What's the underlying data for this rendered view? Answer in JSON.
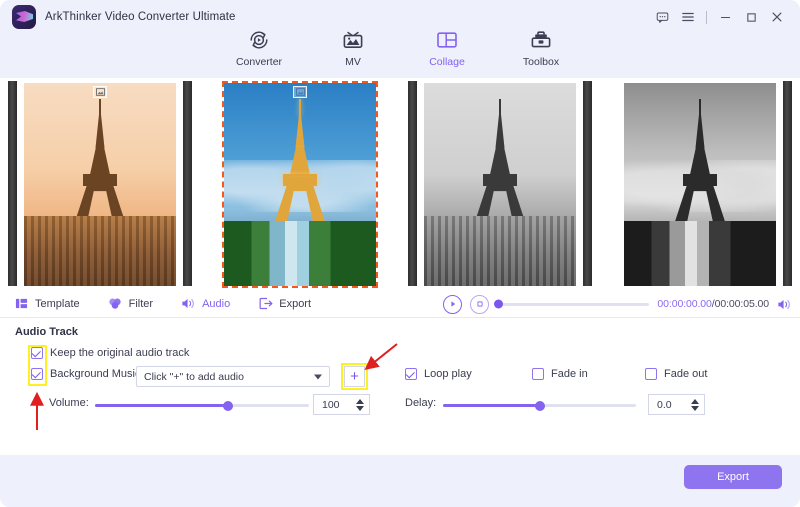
{
  "window": {
    "title": "ArkThinker Video Converter Ultimate",
    "controls": [
      "feedback-icon",
      "menu-icon",
      "minimize-icon",
      "maximize-icon",
      "close-icon"
    ]
  },
  "mainnav": {
    "items": [
      {
        "label": "Converter",
        "icon": "converter-icon",
        "active": false
      },
      {
        "label": "MV",
        "icon": "mv-icon",
        "active": false
      },
      {
        "label": "Collage",
        "icon": "collage-icon",
        "active": true
      },
      {
        "label": "Toolbox",
        "icon": "toolbox-icon",
        "active": false
      }
    ]
  },
  "preview": {
    "cells": [
      {
        "name": "cell-1",
        "style": "sunset",
        "selected": false,
        "badge": "image-badge-icon"
      },
      {
        "name": "cell-2",
        "style": "blue",
        "selected": true,
        "badge": "image-badge-icon"
      },
      {
        "name": "cell-3",
        "style": "grayA",
        "selected": false,
        "badge": ""
      },
      {
        "name": "cell-4",
        "style": "grayB",
        "selected": false,
        "badge": ""
      }
    ]
  },
  "tabs": [
    {
      "label": "Template",
      "icon": "template-icon",
      "active": false
    },
    {
      "label": "Filter",
      "icon": "filter-icon",
      "active": false
    },
    {
      "label": "Audio",
      "icon": "audio-icon",
      "active": true
    },
    {
      "label": "Export",
      "icon": "export-icon",
      "active": false
    }
  ],
  "player": {
    "play_icon": "play-icon",
    "stop_icon": "stop-icon",
    "current_time": "00:00:00.00",
    "separator": "/",
    "total_time": "00:00:05.00",
    "volume_icon": "speaker-icon",
    "seek_percent": 0
  },
  "audio_panel": {
    "title": "Audio Track",
    "keep_original": {
      "label": "Keep the original audio track",
      "checked": true
    },
    "background_music": {
      "label": "Background Music",
      "checked": true
    },
    "music_select": {
      "value": "Click \"+\" to add audio"
    },
    "add_button": {
      "label": "+"
    },
    "loop_play": {
      "label": "Loop play",
      "checked": true
    },
    "fade_in": {
      "label": "Fade in",
      "checked": false
    },
    "fade_out": {
      "label": "Fade out",
      "checked": false
    },
    "volume": {
      "label": "Volume:",
      "value": "100",
      "percent": 62
    },
    "delay": {
      "label": "Delay:",
      "value": "0.0",
      "percent": 50
    }
  },
  "footer": {
    "export_label": "Export"
  },
  "colors": {
    "accent": "#8363f0",
    "accent_button": "#8f74f0",
    "titlebar_bg": "#eef0fb",
    "panel_bg": "#ffffff",
    "selection_border": "#f4581e",
    "highlight": "#fdf024",
    "arrow": "#e02020"
  }
}
